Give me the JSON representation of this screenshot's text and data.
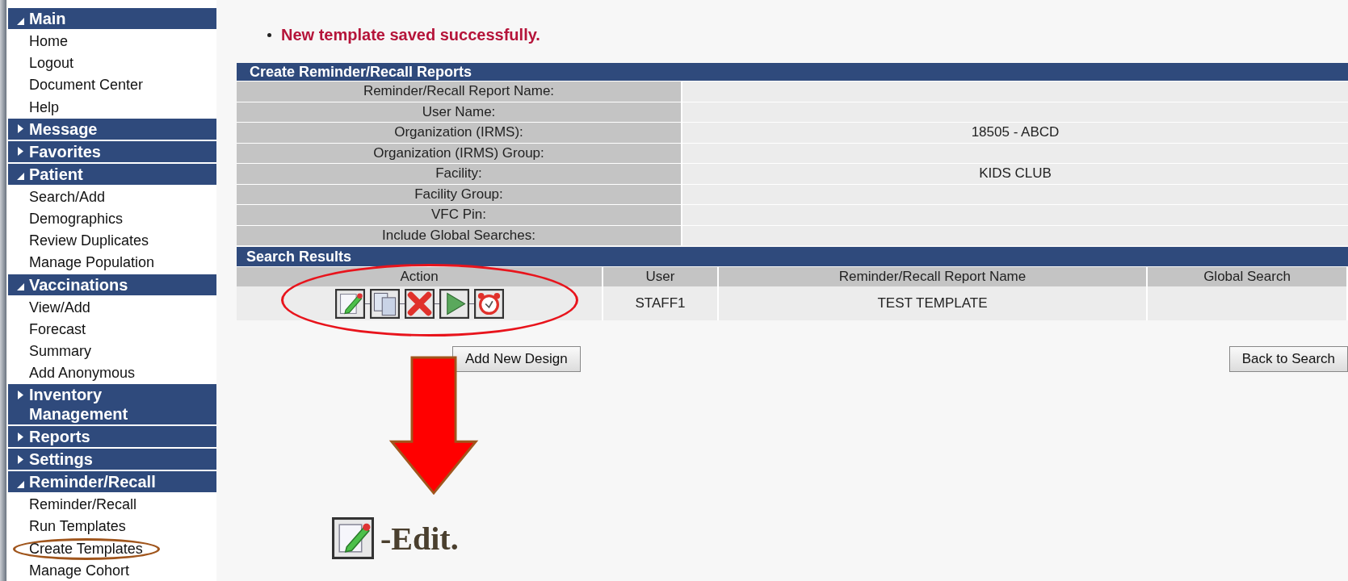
{
  "sidebar": {
    "sections": [
      {
        "title": "Main",
        "expanded": true,
        "items": [
          {
            "label": "Home",
            "circled": false
          },
          {
            "label": "Logout",
            "circled": false
          },
          {
            "label": "Document Center",
            "circled": false
          },
          {
            "label": "Help",
            "circled": false
          }
        ]
      },
      {
        "title": "Message",
        "expanded": false
      },
      {
        "title": "Favorites",
        "expanded": false
      },
      {
        "title": "Patient",
        "expanded": true,
        "items": [
          {
            "label": "Search/Add",
            "circled": false
          },
          {
            "label": "Demographics",
            "circled": false
          },
          {
            "label": "Review Duplicates",
            "circled": false
          },
          {
            "label": "Manage Population",
            "circled": false
          }
        ]
      },
      {
        "title": "Vaccinations",
        "expanded": true,
        "items": [
          {
            "label": "View/Add",
            "circled": false
          },
          {
            "label": "Forecast",
            "circled": false
          },
          {
            "label": "Summary",
            "circled": false
          },
          {
            "label": "Add Anonymous",
            "circled": false
          }
        ]
      },
      {
        "title": "Inventory Management",
        "expanded": false
      },
      {
        "title": "Reports",
        "expanded": false
      },
      {
        "title": "Settings",
        "expanded": false
      },
      {
        "title": "Reminder/Recall",
        "expanded": true,
        "items": [
          {
            "label": "Reminder/Recall",
            "circled": false
          },
          {
            "label": "Run Templates",
            "circled": false
          },
          {
            "label": "Create Templates",
            "circled": true
          },
          {
            "label": "Manage Cohort",
            "circled": false
          }
        ]
      }
    ]
  },
  "message": "New template saved successfully.",
  "form": {
    "title": "Create Reminder/Recall Reports",
    "fields": [
      {
        "label": "Reminder/Recall Report Name:"
      },
      {
        "label": "User Name:"
      },
      {
        "label": "Organization (IRMS):",
        "value": "18505 - ABCD"
      },
      {
        "label": "Organization (IRMS) Group:"
      },
      {
        "label": "Facility:",
        "value": "KIDS CLUB"
      },
      {
        "label": "Facility Group:"
      },
      {
        "label": "VFC Pin:"
      },
      {
        "label": "Include Global Searches:"
      }
    ]
  },
  "results": {
    "title": "Search Results",
    "columns": [
      "Action",
      "User",
      "Reminder/Recall Report Name",
      "Global Search"
    ],
    "rows": [
      {
        "actions": [
          {
            "kind": "edit"
          },
          {
            "kind": "copy"
          },
          {
            "kind": "delete"
          },
          {
            "kind": "run"
          },
          {
            "kind": "alarm"
          }
        ],
        "circled": true,
        "user": "STAFF1",
        "name": "TEST TEMPLATE"
      }
    ]
  },
  "buttons": [
    "Add New Design",
    "Back to Search"
  ],
  "pointer_arrow": true,
  "legend": {
    "kind": "edit",
    "text": "-Edit."
  }
}
